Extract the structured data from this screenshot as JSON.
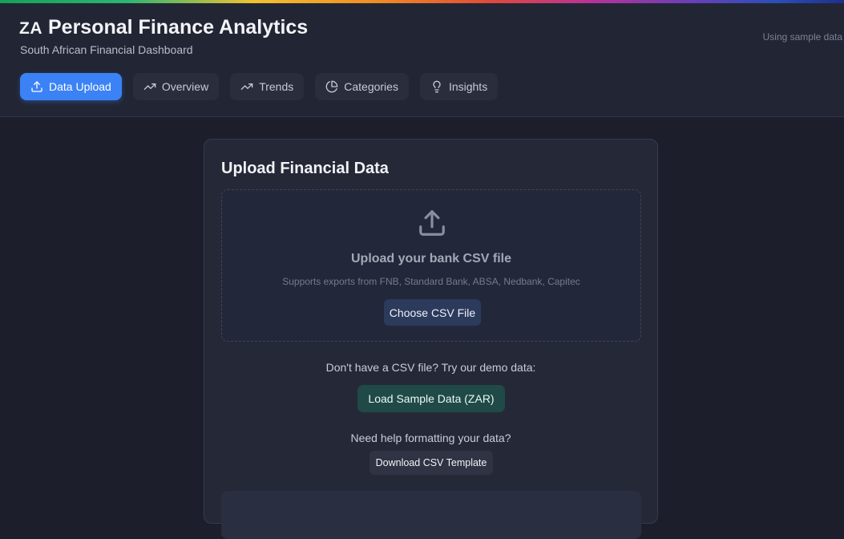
{
  "header": {
    "flag_code": "ZA",
    "title": "Personal Finance Analytics",
    "subtitle": "South African Financial Dashboard",
    "status_note": "Using sample data"
  },
  "nav": {
    "tabs": [
      {
        "label": "Data Upload",
        "icon": "upload-icon",
        "active": true
      },
      {
        "label": "Overview",
        "icon": "trending-up-icon",
        "active": false
      },
      {
        "label": "Trends",
        "icon": "trending-up-icon",
        "active": false
      },
      {
        "label": "Categories",
        "icon": "pie-chart-icon",
        "active": false
      },
      {
        "label": "Insights",
        "icon": "lightbulb-icon",
        "active": false
      }
    ]
  },
  "upload_card": {
    "title": "Upload Financial Data",
    "dropzone": {
      "icon": "upload-icon",
      "title": "Upload your bank CSV file",
      "subtitle": "Supports exports from FNB, Standard Bank, ABSA, Nedbank, Capitec",
      "button_label": "Choose CSV File"
    },
    "demo_prompt": "Don't have a CSV file? Try our demo data:",
    "sample_button_label": "Load Sample Data (ZAR)",
    "help_prompt": "Need help formatting your data?",
    "template_button_label": "Download CSV Template"
  },
  "colors": {
    "accent": "#3b82f6",
    "background": "#1c1f2b",
    "header_bg": "#222634",
    "sample_button": "#1f4a48"
  }
}
